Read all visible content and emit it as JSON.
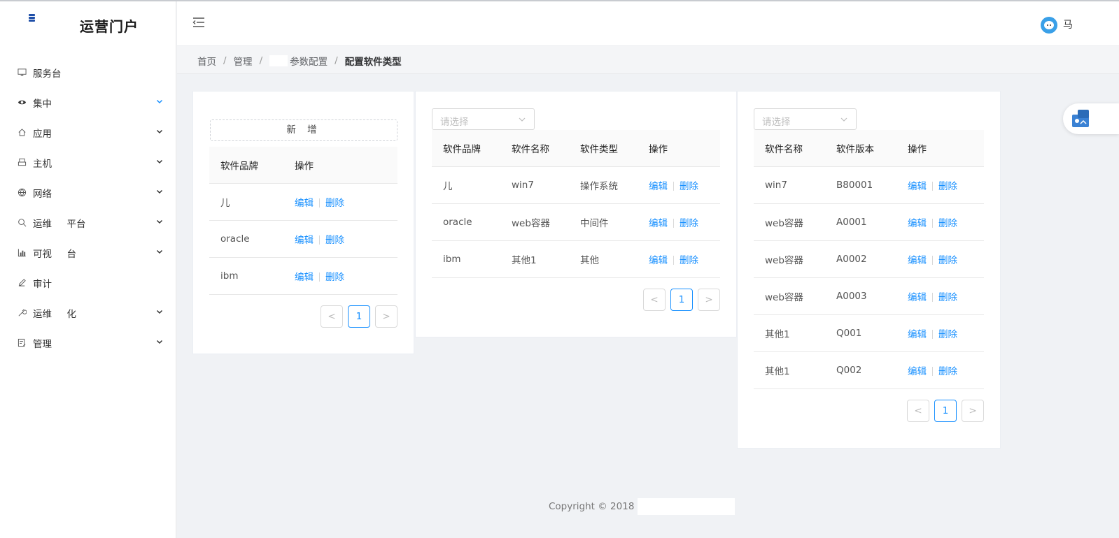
{
  "app": {
    "title": "运营门户"
  },
  "sidebar": {
    "items": [
      {
        "label": "服务台",
        "icon": "monitor-icon",
        "expandable": false
      },
      {
        "label": "集中",
        "icon": "eye-icon",
        "expandable": true,
        "active": true
      },
      {
        "label": "应用",
        "icon": "home-icon",
        "expandable": true
      },
      {
        "label": "主机",
        "icon": "printer-icon",
        "expandable": true
      },
      {
        "label": "网络",
        "icon": "globe-icon",
        "expandable": true
      },
      {
        "label": "运维     平台",
        "icon": "search-icon",
        "expandable": true
      },
      {
        "label": "可视     台",
        "icon": "bar-chart-icon",
        "expandable": true
      },
      {
        "label": "审计",
        "icon": "edit-icon",
        "expandable": false
      },
      {
        "label": "运维     化",
        "icon": "tool-icon",
        "expandable": true
      },
      {
        "label": "管理",
        "icon": "form-icon",
        "expandable": true
      }
    ]
  },
  "header": {
    "username": "马"
  },
  "breadcrumb": {
    "items": [
      "首页",
      "管理",
      "参数配置"
    ],
    "current": "配置软件类型"
  },
  "panel_brand": {
    "add_label": "新 增",
    "columns": [
      "软件品牌",
      "操作"
    ],
    "rows": [
      {
        "brand": "儿"
      },
      {
        "brand": "oracle"
      },
      {
        "brand": "ibm"
      }
    ],
    "page": "1"
  },
  "panel_name": {
    "select_placeholder": "请选择",
    "columns": [
      "软件品牌",
      "软件名称",
      "软件类型",
      "操作"
    ],
    "rows": [
      {
        "brand": "儿",
        "name": "win7",
        "type": "操作系统"
      },
      {
        "brand": "oracle",
        "name": "web容器",
        "type": "中间件"
      },
      {
        "brand": "ibm",
        "name": "其他1",
        "type": "其他"
      }
    ],
    "page": "1"
  },
  "panel_version": {
    "select_placeholder": "请选择",
    "columns": [
      "软件名称",
      "软件版本",
      "操作"
    ],
    "rows": [
      {
        "name": "win7",
        "version": "B80001"
      },
      {
        "name": "web容器",
        "version": "A0001"
      },
      {
        "name": "web容器",
        "version": "A0002"
      },
      {
        "name": "web容器",
        "version": "A0003"
      },
      {
        "name": "其他1",
        "version": "Q001"
      },
      {
        "name": "其他1",
        "version": "Q002"
      }
    ],
    "page": "1"
  },
  "actions": {
    "edit": "编辑",
    "delete": "删除"
  },
  "footer": {
    "copyright": "Copyright © 2018"
  },
  "colors": {
    "accent": "#1890ff",
    "logo": "#1f4fa8"
  }
}
